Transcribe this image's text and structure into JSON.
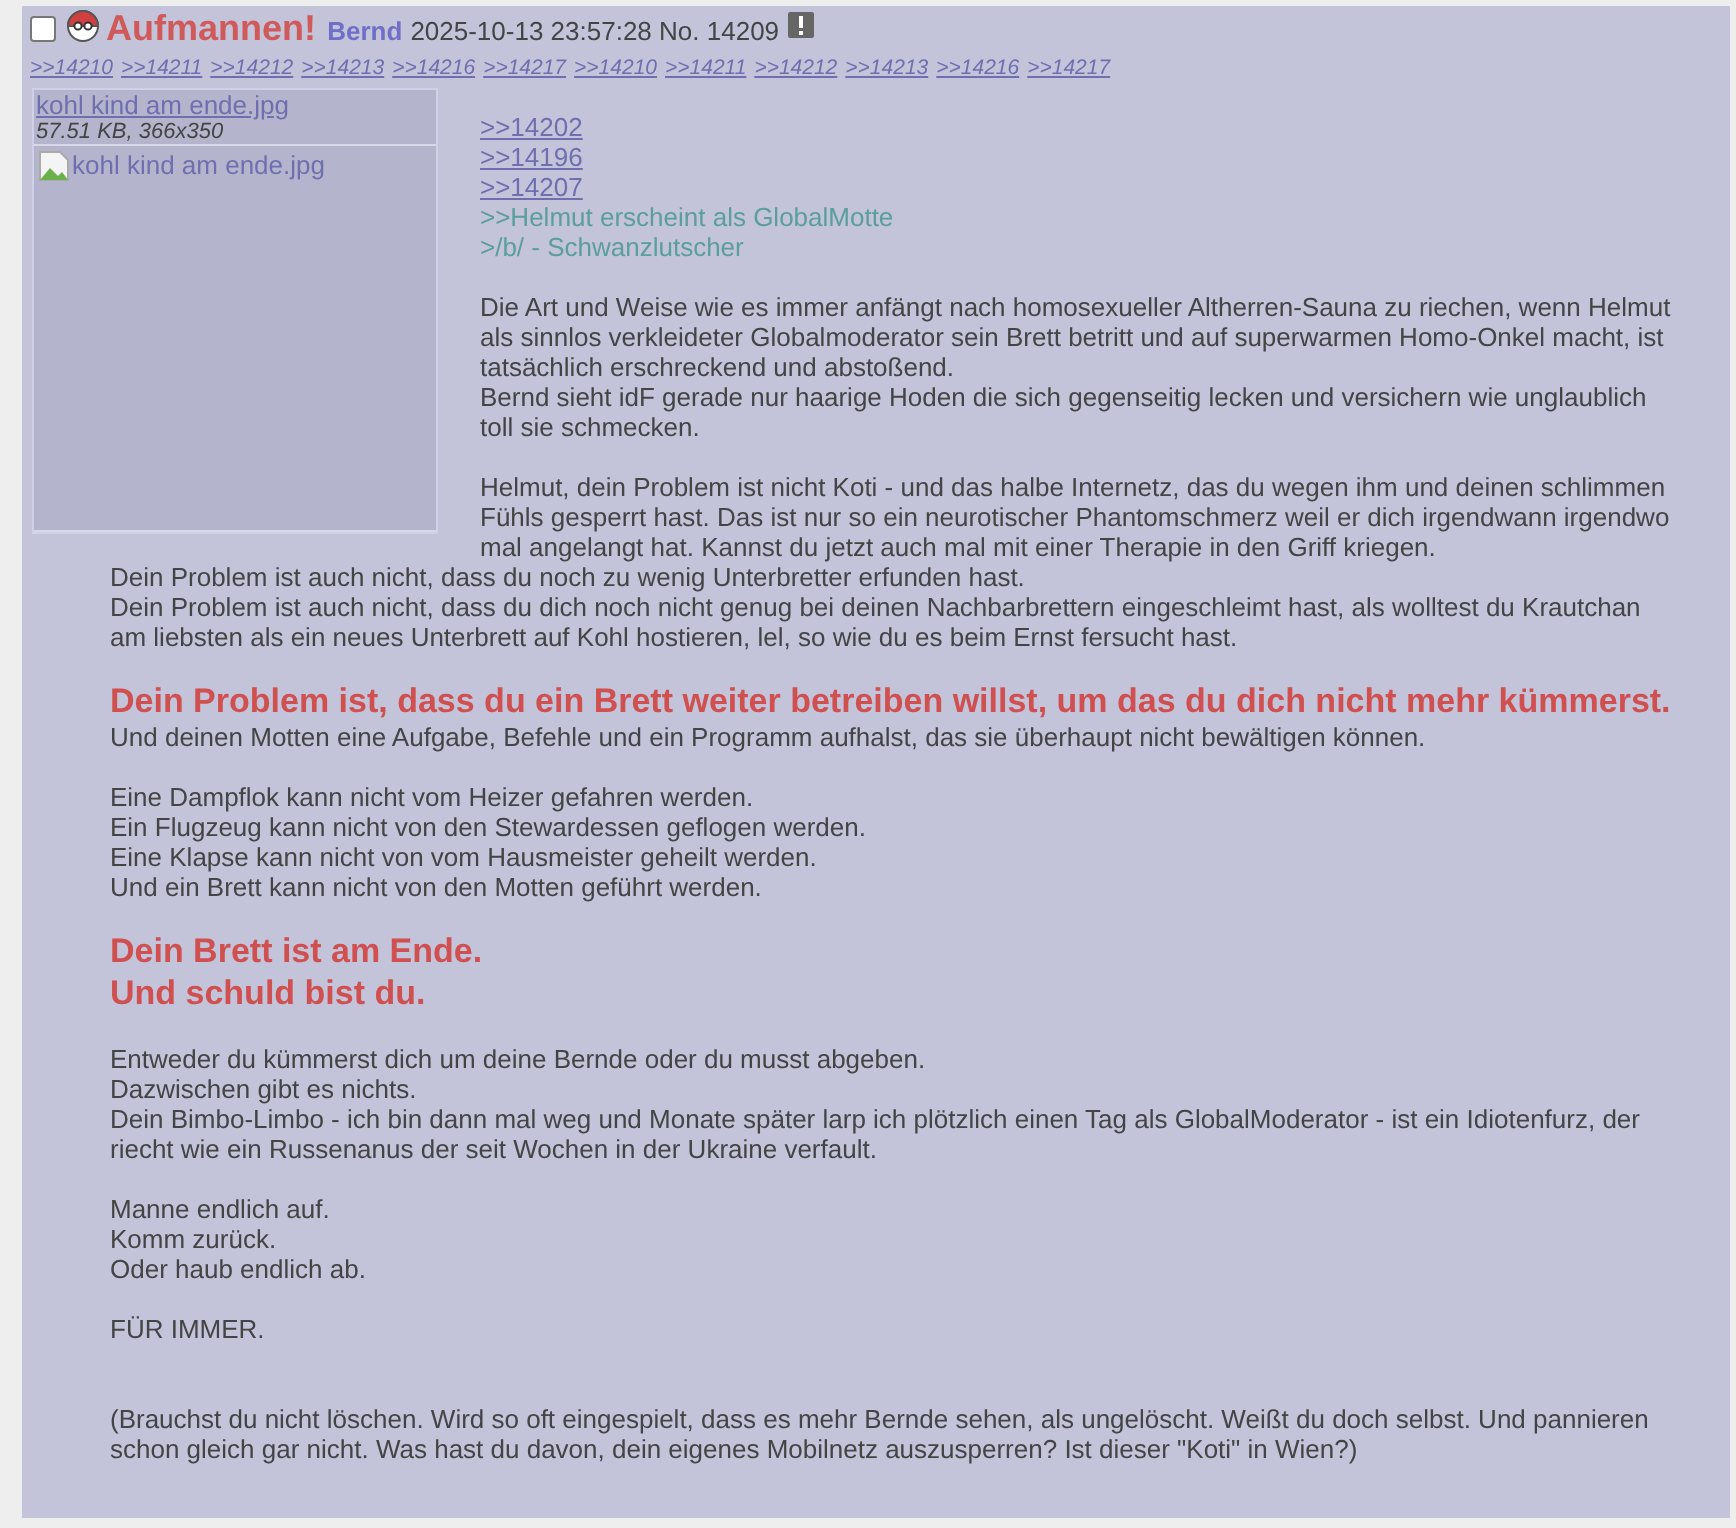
{
  "post": {
    "selected": false,
    "subject": "Aufmannen!",
    "name": "Bernd",
    "date": "2025-10-13 23:57:28",
    "number": "No. 14209",
    "backlinks": [
      ">>14210",
      ">>14211",
      ">>14212",
      ">>14213",
      ">>14216",
      ">>14217",
      ">>14210",
      ">>14211",
      ">>14212",
      ">>14213",
      ">>14216",
      ">>14217"
    ],
    "file": {
      "name": "kohl kind am ende.jpg",
      "info": "57.51 KB, 366x350",
      "alt": "kohl kind am ende.jpg"
    },
    "blocks": [
      {
        "lines": [
          {
            "kind": "ref",
            "text": ">>14202"
          },
          {
            "kind": "ref",
            "text": ">>14196"
          },
          {
            "kind": "ref",
            "text": ">>14207"
          },
          {
            "kind": "quote",
            "text": ">>Helmut erscheint als GlobalMotte"
          },
          {
            "kind": "quote",
            "text": ">/b/ - Schwanzlutscher"
          }
        ]
      },
      {
        "lines": [
          {
            "kind": "text",
            "text": "Die Art und Weise wie es immer anfängt nach homosexueller Altherren-Sauna zu riechen, wenn Helmut als sinnlos verkleideter Globalmoderator sein Brett betritt und auf superwarmen Homo-Onkel macht, ist tatsächlich erschreckend und abstoßend."
          },
          {
            "kind": "text",
            "text": "Bernd sieht idF gerade nur haarige Hoden die sich gegenseitig lecken und versichern wie unglaublich toll sie schmecken."
          }
        ]
      },
      {
        "lines": [
          {
            "kind": "text",
            "text": "Helmut, dein Problem ist nicht Koti - und das halbe Internetz, das du wegen ihm und deinen schlimmen Fühls gesperrt hast. Das ist nur so ein neurotischer Phantomschmerz weil er dich irgendwann irgendwo mal angelangt hat. Kannst du jetzt auch mal mit einer Therapie in den Griff kriegen."
          },
          {
            "kind": "text",
            "text": "Dein Problem ist auch nicht, dass du noch zu wenig Unterbretter erfunden hast."
          },
          {
            "kind": "text",
            "text": "Dein Problem ist auch nicht, dass du dich noch nicht genug bei deinen Nachbarbrettern eingeschleimt hast, als wolltest du Krautchan am liebsten als ein neues Unterbrett auf Kohl hostieren, lel, so wie du es beim Ernst fersucht hast."
          }
        ]
      },
      {
        "lines": [
          {
            "kind": "heading",
            "text": "Dein Problem ist, dass du ein Brett weiter betreiben willst, um das du dich nicht mehr kümmerst."
          },
          {
            "kind": "text",
            "text": "Und deinen Motten eine Aufgabe, Befehle und ein Programm aufhalst, das sie überhaupt nicht bewältigen können."
          }
        ]
      },
      {
        "lines": [
          {
            "kind": "text",
            "text": "Eine Dampflok kann nicht vom Heizer gefahren werden."
          },
          {
            "kind": "text",
            "text": "Ein Flugzeug kann nicht von den Stewardessen geflogen werden."
          },
          {
            "kind": "text",
            "text": "Eine Klapse kann nicht von vom Hausmeister geheilt werden."
          },
          {
            "kind": "text",
            "text": "Und ein Brett kann nicht von den Motten geführt werden."
          }
        ]
      },
      {
        "lines": [
          {
            "kind": "heading",
            "text": "Dein Brett ist am Ende."
          },
          {
            "kind": "heading",
            "text": "Und schuld bist du."
          }
        ]
      },
      {
        "lines": [
          {
            "kind": "text",
            "text": "Entweder du kümmerst dich um deine Bernde oder du musst abgeben."
          },
          {
            "kind": "text",
            "text": "Dazwischen gibt es nichts."
          },
          {
            "kind": "text",
            "text": "Dein Bimbo-Limbo - ich bin dann mal weg und Monate später larp ich plötzlich einen Tag als GlobalModerator - ist ein Idiotenfurz, der riecht wie ein Russenanus der seit Wochen in der Ukraine verfault."
          }
        ]
      },
      {
        "lines": [
          {
            "kind": "text",
            "text": "Manne endlich auf."
          },
          {
            "kind": "text",
            "text": "Komm zurück."
          },
          {
            "kind": "text",
            "text": "Oder haub endlich ab."
          }
        ]
      },
      {
        "lines": [
          {
            "kind": "text",
            "text": "FÜR IMMER."
          }
        ]
      },
      {
        "lines": [
          {
            "kind": "text",
            "text": "(Brauchst du nicht löschen. Wird so oft eingespielt, dass es mehr Bernde sehen, als ungelöscht. Weißt du doch selbst. Und pannieren schon gleich gar nicht. Was hast du davon, dein eigenes Mobilnetz auszusperren? Ist dieser \"Koti\" in Wien?)"
          }
        ]
      }
    ]
  }
}
